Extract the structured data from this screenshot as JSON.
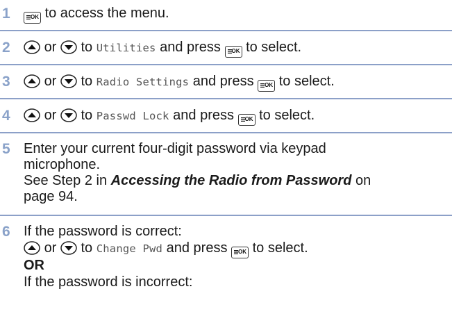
{
  "keys": {
    "ok_key_label": "OK"
  },
  "steps": [
    {
      "number": "1",
      "t1": "to access the menu."
    },
    {
      "number": "2",
      "or": "or",
      "to": "to",
      "target": "Utilities",
      "press": "and press",
      "select": "to select."
    },
    {
      "number": "3",
      "or": "or",
      "to": "to",
      "target": "Radio Settings",
      "press": "and press",
      "select": "to select."
    },
    {
      "number": "4",
      "or": "or",
      "to": "to",
      "target": "Passwd Lock",
      "press": "and press",
      "select": "to select."
    },
    {
      "number": "5",
      "line1": "Enter your current four-digit password via keypad",
      "line2": "microphone.",
      "line3_pre": "See Step 2 in ",
      "line3_ref": "Accessing the Radio from Password",
      "line3_post": " on",
      "line4": "page 94."
    },
    {
      "number": "6",
      "line1": "If the password is correct:",
      "or": "or",
      "to": "to",
      "target": "Change Pwd",
      "press": "and press",
      "select": "to select.",
      "or_label": "OR",
      "line4": "If the password is incorrect:"
    }
  ],
  "colors": {
    "accent": "#8aa2c9",
    "rule": "#8ca0c8",
    "mono_text": "#555555"
  }
}
